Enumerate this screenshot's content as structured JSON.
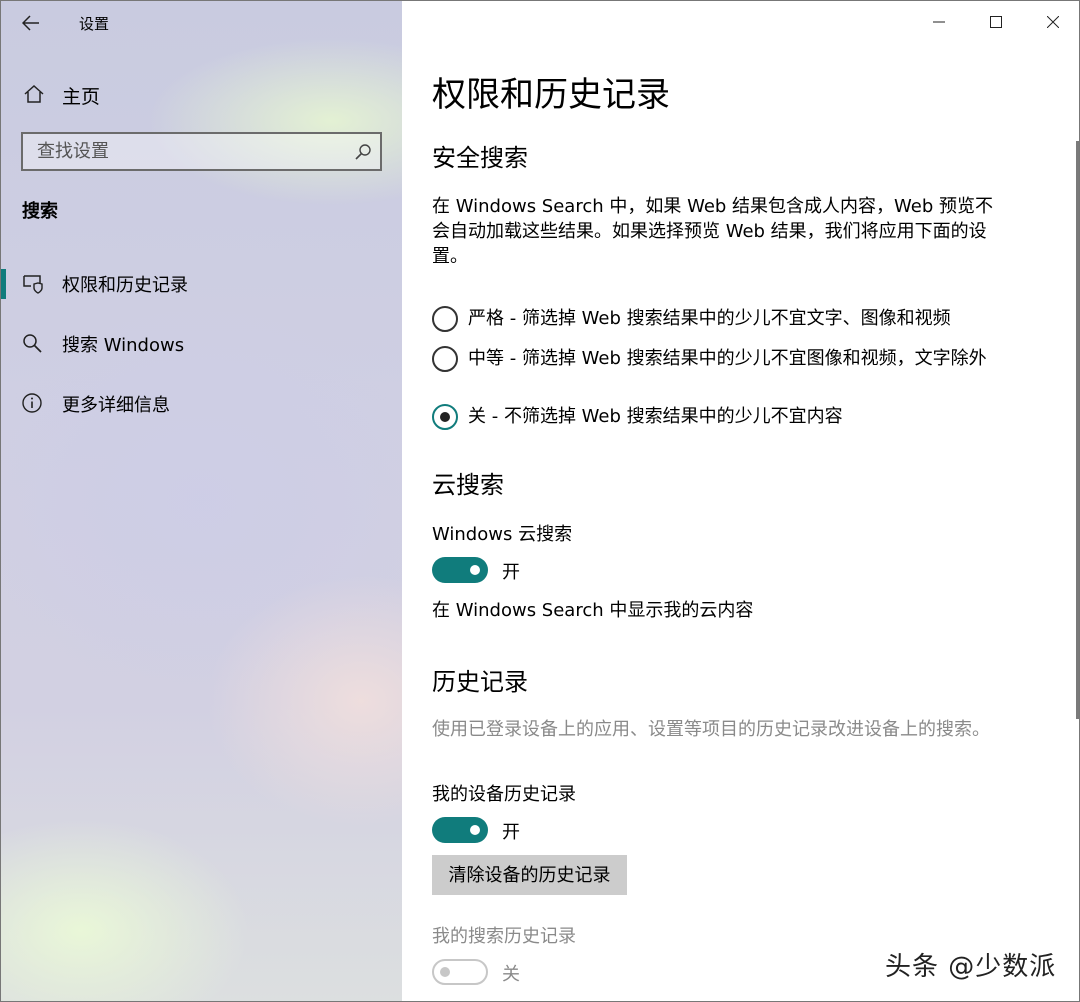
{
  "app": {
    "title": "设置"
  },
  "sidebar": {
    "home_label": "主页",
    "search_placeholder": "查找设置",
    "section_label": "搜索",
    "items": [
      {
        "label": "权限和历史记录",
        "icon": "permissions-shield-icon",
        "selected": true
      },
      {
        "label": "搜索 Windows",
        "icon": "search-icon",
        "selected": false
      },
      {
        "label": "更多详细信息",
        "icon": "info-icon",
        "selected": false
      }
    ]
  },
  "main": {
    "title": "权限和历史记录",
    "safe_search": {
      "heading": "安全搜索",
      "description": "在 Windows Search 中，如果 Web 结果包含成人内容，Web 预览不会自动加载这些结果。如果选择预览 Web 结果，我们将应用下面的设置。",
      "options": [
        {
          "label": "严格 - 筛选掉 Web 搜索结果中的少儿不宜文字、图像和视频",
          "checked": false
        },
        {
          "label": "中等 - 筛选掉 Web 搜索结果中的少儿不宜图像和视频，文字除外",
          "checked": false
        },
        {
          "label": "关 - 不筛选掉 Web 搜索结果中的少儿不宜内容",
          "checked": true
        }
      ]
    },
    "cloud_search": {
      "heading": "云搜索",
      "toggle_label": "Windows 云搜索",
      "toggle_state": "开",
      "toggle_on": true,
      "note": "在 Windows Search 中显示我的云内容"
    },
    "history": {
      "heading": "历史记录",
      "description": "使用已登录设备上的应用、设置等项目的历史记录改进设备上的搜索。",
      "device_history_label": "我的设备历史记录",
      "device_history_state": "开",
      "device_history_on": true,
      "clear_button": "清除设备的历史记录",
      "search_history_label": "我的搜索历史记录",
      "search_history_state": "关",
      "search_history_on": false
    }
  },
  "watermark": "头条 @少数派",
  "colors": {
    "accent": "#107c7c",
    "disabled": "#8a8a8a"
  }
}
